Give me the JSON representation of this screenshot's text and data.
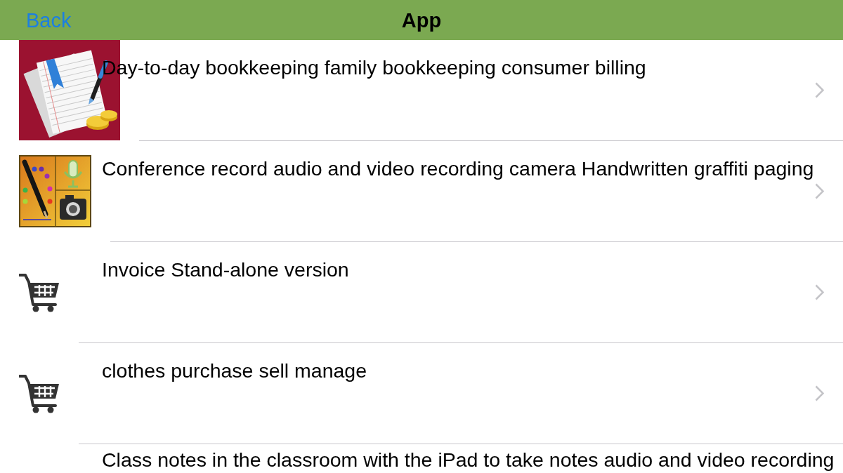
{
  "nav_bar": {
    "back": "Back",
    "title": "App"
  },
  "rows": [
    {
      "kind": "notes",
      "title": "Day-to-day bookkeeping family bookkeeping consumer billing"
    },
    {
      "kind": "media",
      "title": "Conference record audio and video recording camera Handwritten graffiti paging"
    },
    {
      "kind": "cart",
      "title": "Invoice Stand-alone version"
    },
    {
      "kind": "cart",
      "title": "clothes purchase sell manage"
    },
    {
      "kind": "partial",
      "title": "Class notes in the classroom with the iPad to take notes audio and video recording"
    }
  ]
}
